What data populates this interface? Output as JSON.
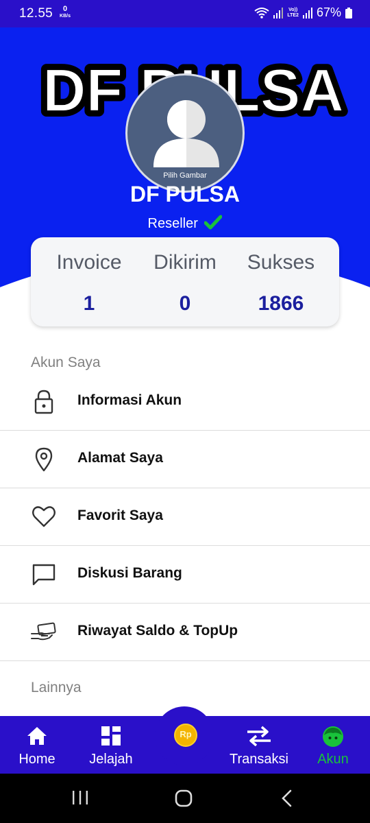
{
  "status_bar": {
    "time": "12.55",
    "net_speed_value": "0",
    "net_speed_unit": "KB/s",
    "lte_label_top": "Vo))",
    "lte_label_bottom": "LTE2",
    "battery": "67%"
  },
  "header": {
    "logo_text": "DF PULSA",
    "avatar_caption": "Pilih Gambar",
    "profile_name": "DF PULSA",
    "role": "Reseller",
    "colors": {
      "header_bg": "#0a21f0",
      "accent_bar": "#2a10c9",
      "verified": "#19c23b"
    }
  },
  "stats": [
    {
      "label": "Invoice",
      "value": "1"
    },
    {
      "label": "Dikirim",
      "value": "0"
    },
    {
      "label": "Sukses",
      "value": "1866"
    }
  ],
  "sections": {
    "account_title": "Akun Saya",
    "other_title": "Lainnya"
  },
  "menu": [
    {
      "label": "Informasi Akun",
      "icon": "lock-icon"
    },
    {
      "label": "Alamat Saya",
      "icon": "location-pin-icon"
    },
    {
      "label": "Favorit Saya",
      "icon": "heart-icon"
    },
    {
      "label": "Diskusi Barang",
      "icon": "chat-icon"
    },
    {
      "label": "Riwayat Saldo & TopUp",
      "icon": "hand-card-icon"
    }
  ],
  "bottom_nav": [
    {
      "label": "Home",
      "icon": "home-icon"
    },
    {
      "label": "Jelajah",
      "icon": "grid-icon"
    },
    {
      "label": "Transaksi",
      "icon": "swap-arrows-icon"
    },
    {
      "label": "Akun",
      "icon": "face-icon",
      "active": true
    }
  ],
  "fab": {
    "icon": "rupiah-coin-icon",
    "text": "Rp"
  }
}
